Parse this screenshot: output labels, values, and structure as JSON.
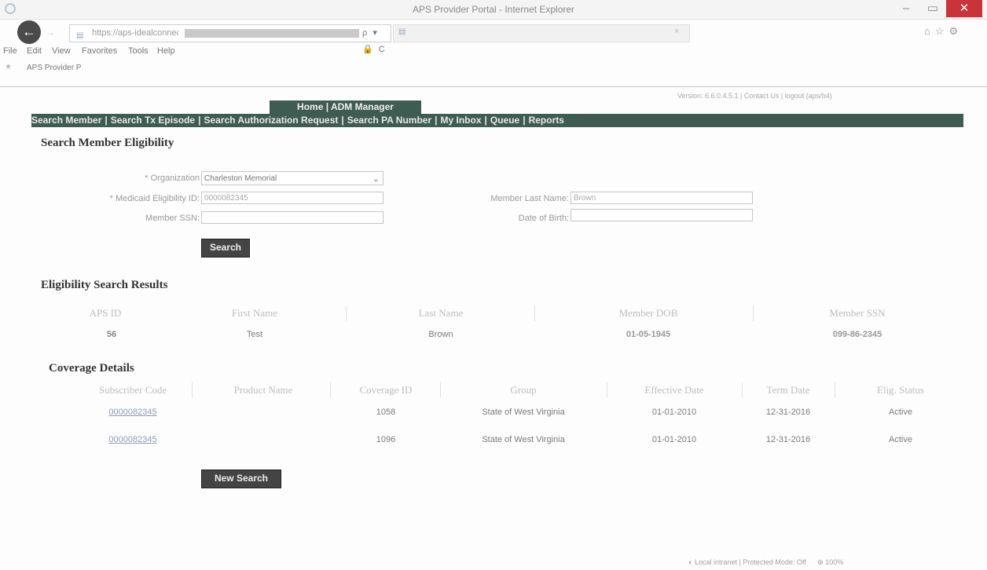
{
  "browser": {
    "window_title": "APS Provider Portal - Internet Explorer",
    "url": "https://aps-idealconnect.dev.org",
    "address_icons": "ρ ▾ 🔒 C",
    "menu": [
      "File",
      "Edit",
      "View",
      "Favorites",
      "Tools",
      "Help"
    ],
    "favorite": "APS Provider P",
    "status": "Local intranet | Protected Mode: Off",
    "zoom": "100%"
  },
  "portal": {
    "version": "Version: 6.6.0.4.5.1 | Contact Us | logout (aps/b4)",
    "home_tab": "Home | ADM Manager",
    "nav": [
      "Search Member",
      "Search Tx Episode",
      "Search Authorization Request",
      "Search PA Number",
      "My Inbox",
      "Queue",
      "Reports"
    ]
  },
  "search": {
    "title": "Search Member Eligibility",
    "organization_label": "* Organization",
    "organization_value": "Charleston Memorial",
    "medicaid_label": "* Medicaid Eligibility ID:",
    "medicaid_value": "0000082345",
    "last_name_label": "Member Last Name:",
    "last_name_value": "Brown",
    "ssn_label": "Member SSN:",
    "ssn_value": "",
    "dob_label": "Date of Birth:",
    "dob_value": "",
    "search_button": "Search"
  },
  "eligibility": {
    "title": "Eligibility Search Results",
    "columns": [
      "APS ID",
      "First Name",
      "Last Name",
      "Member DOB",
      "Member SSN"
    ],
    "row": [
      "56",
      "Test",
      "Brown",
      "01-05-1945",
      "099-86-2345"
    ]
  },
  "coverage": {
    "title": "Coverage Details",
    "columns": [
      "Subscriber Code",
      "Product Name",
      "Coverage ID",
      "Group",
      "Effective Date",
      "Term Date",
      "Elig. Status"
    ],
    "rows": [
      [
        "0000082345",
        "",
        "1058",
        "State of West Virginia",
        "01-01-2010",
        "12-31-2016",
        "Active"
      ],
      [
        "0000082345",
        "",
        "1096",
        "State of West Virginia",
        "01-01-2010",
        "12-31-2016",
        "Active"
      ]
    ],
    "new_search_button": "New Search"
  }
}
